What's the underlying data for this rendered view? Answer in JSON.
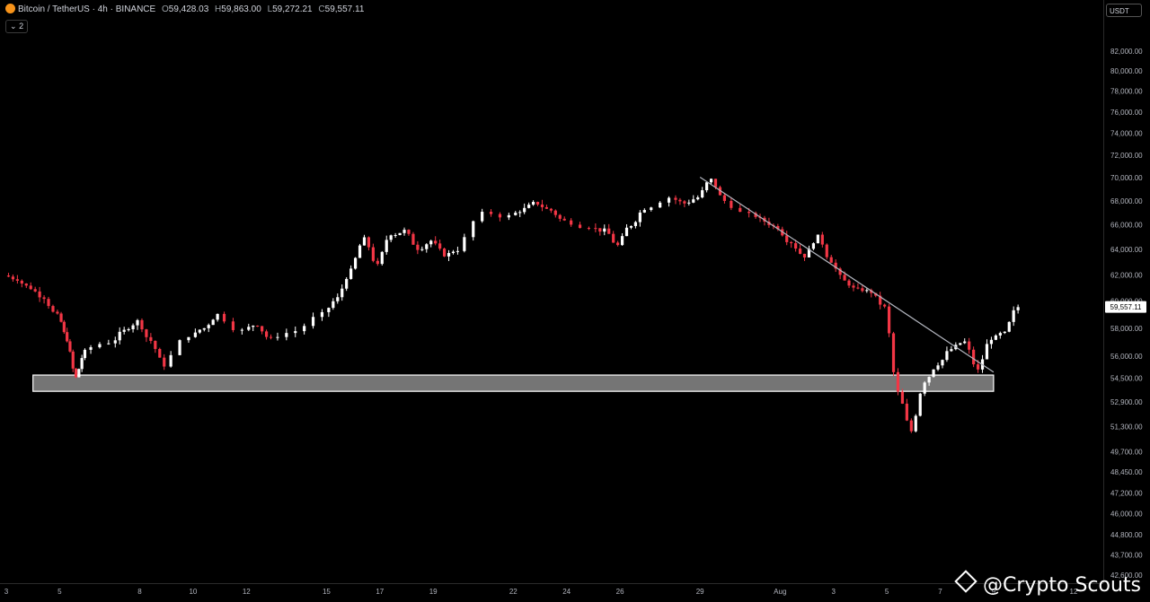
{
  "header": {
    "symbol": "Bitcoin / TetherUS · 4h · BINANCE",
    "open_label": "O",
    "open": "59,428.03",
    "high_label": "H",
    "high": "59,863.00",
    "low_label": "L",
    "low": "59,272.21",
    "close_label": "C",
    "close": "59,557.11",
    "indicator_count": "2"
  },
  "currency_button": "USDT",
  "watermark": "@Crypto Scouts",
  "colors": {
    "up": "#ffffff",
    "down": "#f23645",
    "zone": "#ffffff",
    "trendline": "#b2b5be",
    "background": "#000000"
  },
  "chart_data": {
    "type": "candlestick",
    "title": "",
    "timeframe": "4h",
    "last_price": 59557.11,
    "y_axis": {
      "scale": "log",
      "range": [
        42000,
        85500
      ],
      "ticks": [
        {
          "value": 82000,
          "label": "82,000.00"
        },
        {
          "value": 80000,
          "label": "80,000.00"
        },
        {
          "value": 78000,
          "label": "78,000.00"
        },
        {
          "value": 76000,
          "label": "76,000.00"
        },
        {
          "value": 74000,
          "label": "74,000.00"
        },
        {
          "value": 72000,
          "label": "72,000.00"
        },
        {
          "value": 70000,
          "label": "70,000.00"
        },
        {
          "value": 68000,
          "label": "68,000.00"
        },
        {
          "value": 66000,
          "label": "66,000.00"
        },
        {
          "value": 64000,
          "label": "64,000.00"
        },
        {
          "value": 62000,
          "label": "62,000.00"
        },
        {
          "value": 60000,
          "label": "60,000.00"
        },
        {
          "value": 58000,
          "label": "58,000.00"
        },
        {
          "value": 56000,
          "label": "56,000.00"
        },
        {
          "value": 54500,
          "label": "54,500.00"
        },
        {
          "value": 52900,
          "label": "52,900.00"
        },
        {
          "value": 51300,
          "label": "51,300.00"
        },
        {
          "value": 49700,
          "label": "49,700.00"
        },
        {
          "value": 48450,
          "label": "48,450.00"
        },
        {
          "value": 47200,
          "label": "47,200.00"
        },
        {
          "value": 46000,
          "label": "46,000.00"
        },
        {
          "value": 44800,
          "label": "44,800.00"
        },
        {
          "value": 43700,
          "label": "43,700.00"
        },
        {
          "value": 42600,
          "label": "42,600.00"
        }
      ]
    },
    "x_axis": {
      "range": [
        "2024-07-03",
        "2024-08-12"
      ],
      "ticks": [
        {
          "date": "2024-07-03",
          "label": "3"
        },
        {
          "date": "2024-07-05",
          "label": "5"
        },
        {
          "date": "2024-07-08",
          "label": "8"
        },
        {
          "date": "2024-07-10",
          "label": "10"
        },
        {
          "date": "2024-07-12",
          "label": "12"
        },
        {
          "date": "2024-07-15",
          "label": "15"
        },
        {
          "date": "2024-07-17",
          "label": "17"
        },
        {
          "date": "2024-07-19",
          "label": "19"
        },
        {
          "date": "2024-07-22",
          "label": "22"
        },
        {
          "date": "2024-07-24",
          "label": "24"
        },
        {
          "date": "2024-07-26",
          "label": "26"
        },
        {
          "date": "2024-07-29",
          "label": "29"
        },
        {
          "date": "2024-08-01",
          "label": "Aug"
        },
        {
          "date": "2024-08-03",
          "label": "3"
        },
        {
          "date": "2024-08-05",
          "label": "5"
        },
        {
          "date": "2024-08-07",
          "label": "7"
        },
        {
          "date": "2024-08-09",
          "label": "9"
        },
        {
          "date": "2024-08-12",
          "label": "12"
        }
      ]
    },
    "support_zone": {
      "start": "2024-07-04",
      "end": "2024-08-09",
      "low": 53600,
      "high": 54700
    },
    "trendline": {
      "start": {
        "date": "2024-07-29",
        "price": 70050
      },
      "end": {
        "date": "2024-08-09",
        "price": 54900
      }
    },
    "price_path": [
      {
        "date": "2024-07-03",
        "price": 61700
      },
      {
        "date": "2024-07-03",
        "price": 61000
      },
      {
        "date": "2024-07-04",
        "price": 60300
      },
      {
        "date": "2024-07-04",
        "price": 58900
      },
      {
        "date": "2024-07-05",
        "price": 57200
      },
      {
        "date": "2024-07-05",
        "price": 54500
      },
      {
        "date": "2024-07-05",
        "price": 56300
      },
      {
        "date": "2024-07-06",
        "price": 57000
      },
      {
        "date": "2024-07-07",
        "price": 57800
      },
      {
        "date": "2024-07-07",
        "price": 58500
      },
      {
        "date": "2024-07-08",
        "price": 57100
      },
      {
        "date": "2024-07-08",
        "price": 55400
      },
      {
        "date": "2024-07-09",
        "price": 57500
      },
      {
        "date": "2024-07-10",
        "price": 58000
      },
      {
        "date": "2024-07-10",
        "price": 59000
      },
      {
        "date": "2024-07-11",
        "price": 57800
      },
      {
        "date": "2024-07-12",
        "price": 58300
      },
      {
        "date": "2024-07-12",
        "price": 57200
      },
      {
        "date": "2024-07-13",
        "price": 57800
      },
      {
        "date": "2024-07-14",
        "price": 59000
      },
      {
        "date": "2024-07-15",
        "price": 60200
      },
      {
        "date": "2024-07-15",
        "price": 62300
      },
      {
        "date": "2024-07-16",
        "price": 64800
      },
      {
        "date": "2024-07-16",
        "price": 62700
      },
      {
        "date": "2024-07-17",
        "price": 65300
      },
      {
        "date": "2024-07-17",
        "price": 65500
      },
      {
        "date": "2024-07-18",
        "price": 64100
      },
      {
        "date": "2024-07-18",
        "price": 64700
      },
      {
        "date": "2024-07-19",
        "price": 63600
      },
      {
        "date": "2024-07-19",
        "price": 64000
      },
      {
        "date": "2024-07-20",
        "price": 66900
      },
      {
        "date": "2024-07-21",
        "price": 66700
      },
      {
        "date": "2024-07-22",
        "price": 67300
      },
      {
        "date": "2024-07-22",
        "price": 67800
      },
      {
        "date": "2024-07-23",
        "price": 67200
      },
      {
        "date": "2024-07-23",
        "price": 66300
      },
      {
        "date": "2024-07-24",
        "price": 65900
      },
      {
        "date": "2024-07-25",
        "price": 65500
      },
      {
        "date": "2024-07-25",
        "price": 64300
      },
      {
        "date": "2024-07-26",
        "price": 66000
      },
      {
        "date": "2024-07-26",
        "price": 67400
      },
      {
        "date": "2024-07-27",
        "price": 68300
      },
      {
        "date": "2024-07-28",
        "price": 67800
      },
      {
        "date": "2024-07-28",
        "price": 68300
      },
      {
        "date": "2024-07-29",
        "price": 69800
      },
      {
        "date": "2024-07-29",
        "price": 68000
      },
      {
        "date": "2024-07-30",
        "price": 66800
      },
      {
        "date": "2024-07-31",
        "price": 66300
      },
      {
        "date": "2024-07-31",
        "price": 65800
      },
      {
        "date": "2024-08-01",
        "price": 64600
      },
      {
        "date": "2024-08-01",
        "price": 63500
      },
      {
        "date": "2024-08-02",
        "price": 65000
      },
      {
        "date": "2024-08-02",
        "price": 63100
      },
      {
        "date": "2024-08-03",
        "price": 61500
      },
      {
        "date": "2024-08-03",
        "price": 60800
      },
      {
        "date": "2024-08-04",
        "price": 60700
      },
      {
        "date": "2024-08-04",
        "price": 59500
      },
      {
        "date": "2024-08-05",
        "price": 53500
      },
      {
        "date": "2024-08-05",
        "price": 51000
      },
      {
        "date": "2024-08-06",
        "price": 54300
      },
      {
        "date": "2024-08-06",
        "price": 55500
      },
      {
        "date": "2024-08-07",
        "price": 56500
      },
      {
        "date": "2024-08-07",
        "price": 57000
      },
      {
        "date": "2024-08-08",
        "price": 55000
      },
      {
        "date": "2024-08-08",
        "price": 57300
      },
      {
        "date": "2024-08-09",
        "price": 57600
      },
      {
        "date": "2024-08-09",
        "price": 59557.11
      }
    ],
    "annotations": []
  }
}
